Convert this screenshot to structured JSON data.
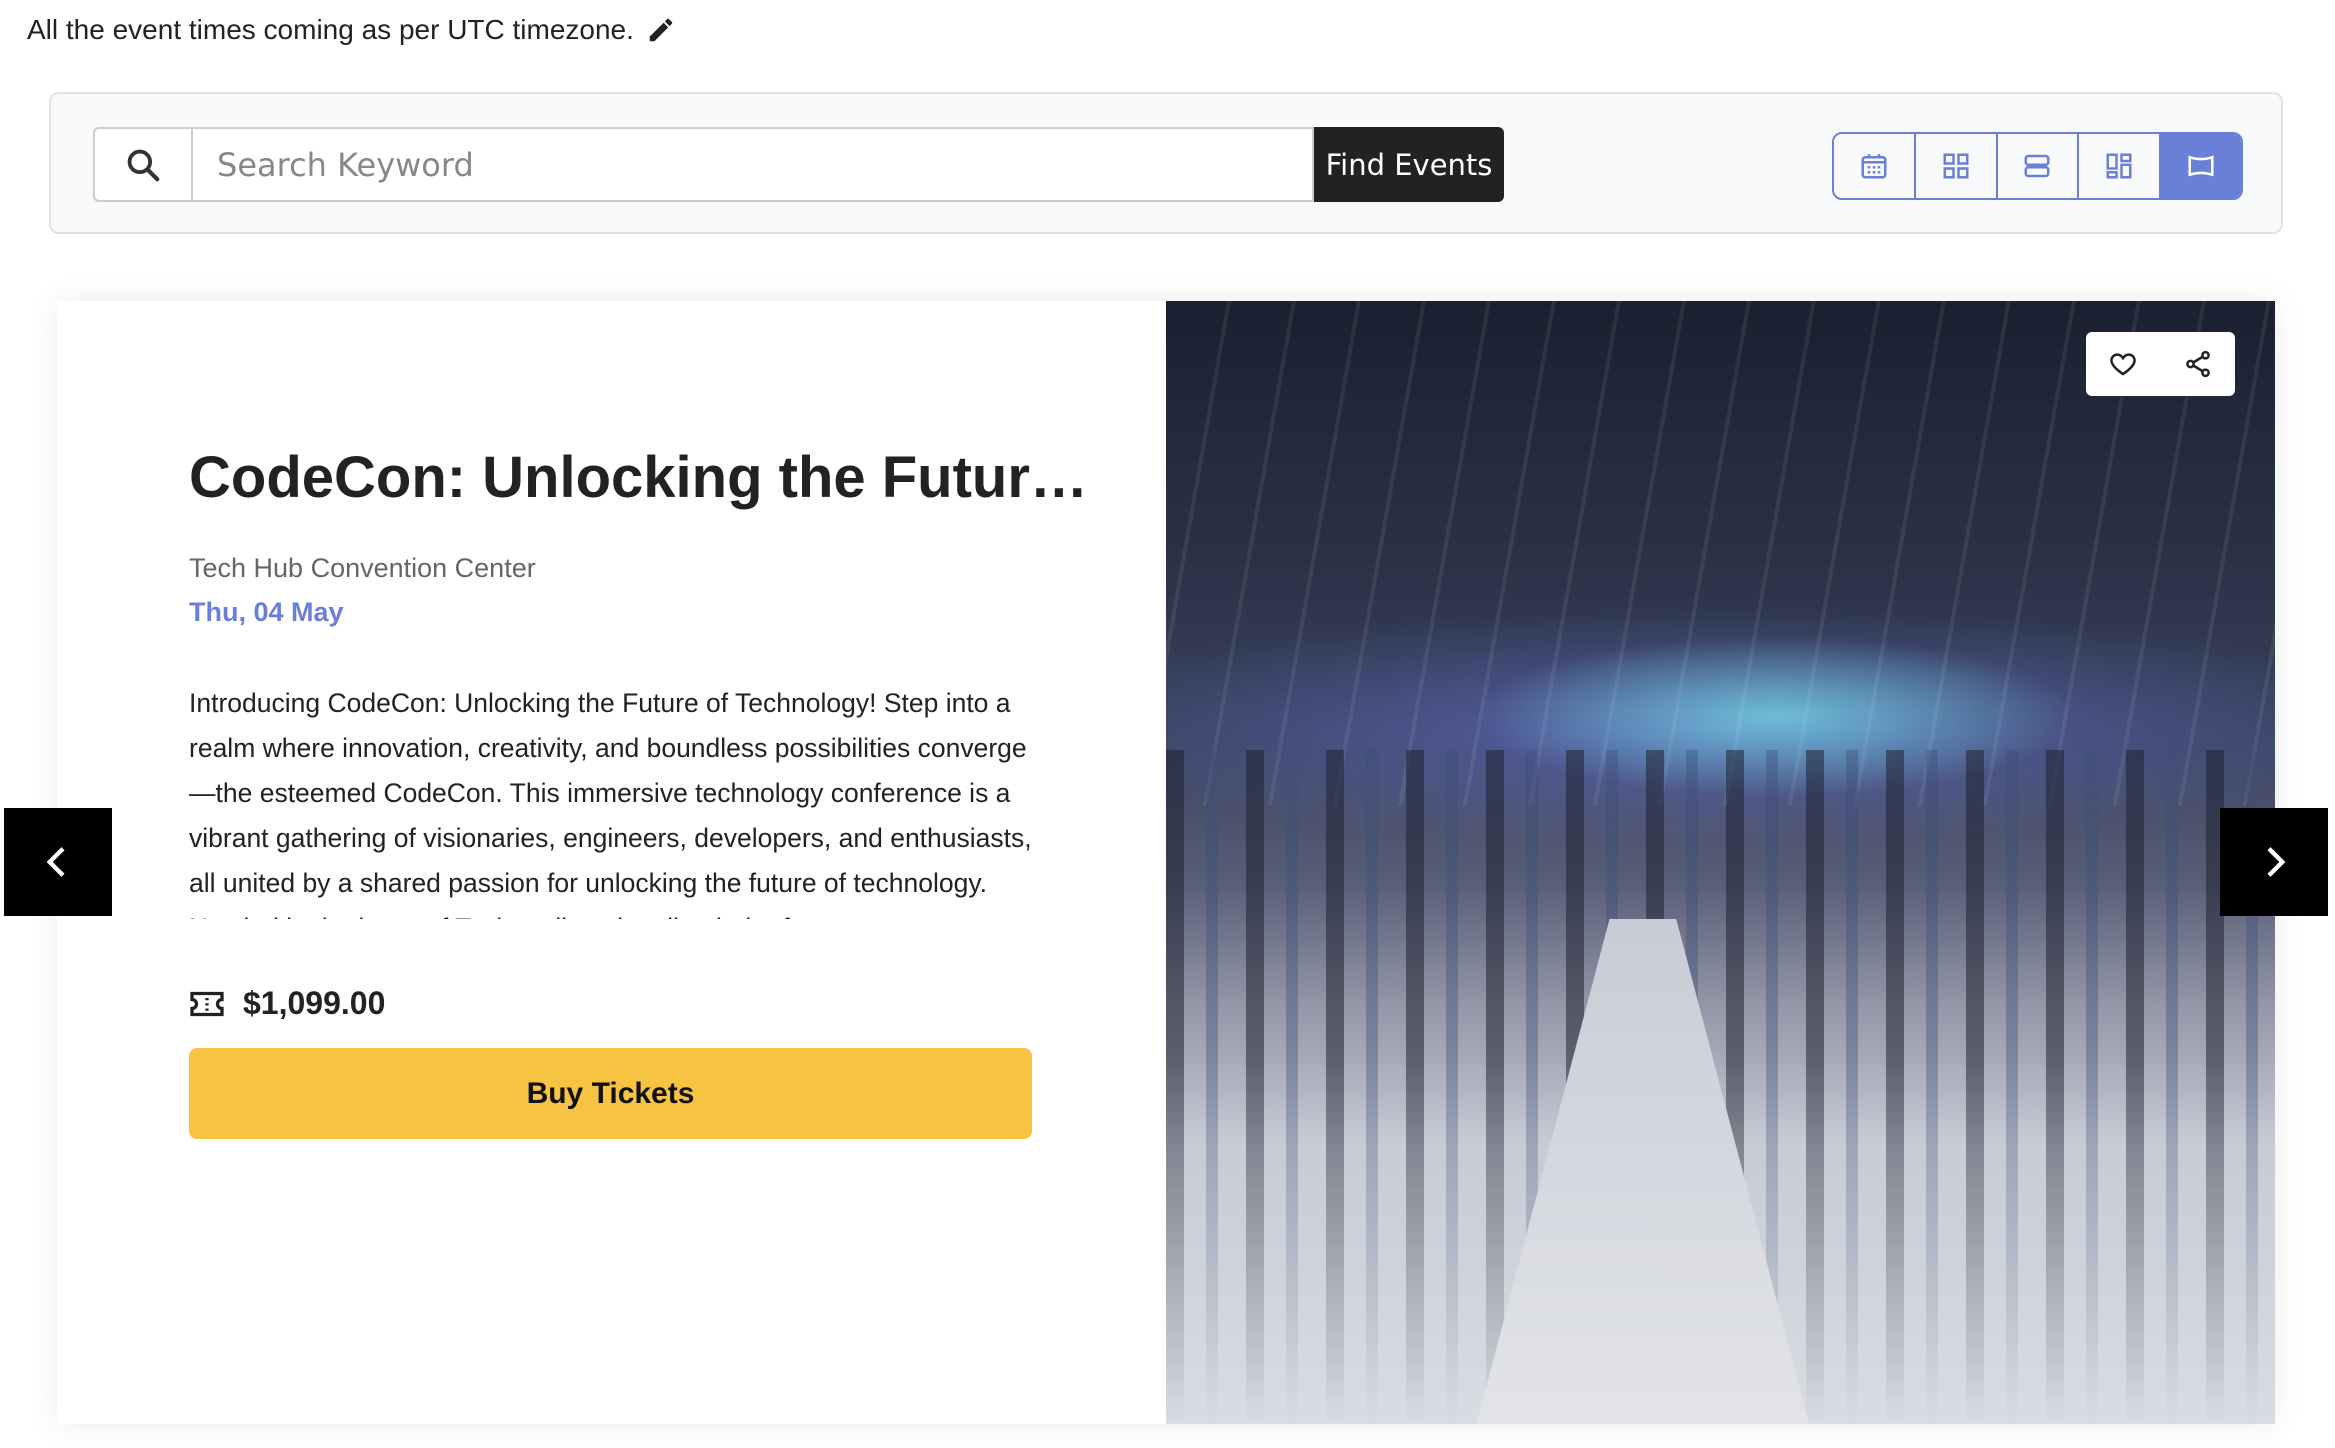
{
  "timezone_notice": {
    "text": "All the event times coming as per UTC timezone.",
    "icon": "pencil-icon"
  },
  "search": {
    "placeholder": "Search Keyword",
    "value": "",
    "button_label": "Find Events",
    "icon": "search-icon"
  },
  "view_toggles": [
    {
      "name": "calendar-view",
      "icon": "calendar-icon",
      "active": false
    },
    {
      "name": "grid-view",
      "icon": "grid-icon",
      "active": false
    },
    {
      "name": "list-view",
      "icon": "list-icon",
      "active": false
    },
    {
      "name": "masonry-view",
      "icon": "masonry-icon",
      "active": false
    },
    {
      "name": "slider-view",
      "icon": "slider-icon",
      "active": true
    }
  ],
  "event": {
    "title": "CodeCon: Unlocking the Future of Technology",
    "venue": "Tech Hub Convention Center",
    "date": "Thu, 04 May",
    "description": "Introducing CodeCon: Unlocking the Future of Technology! Step into a realm where innovation, creativity, and boundless possibilities converge—the esteemed CodeCon. This immersive technology conference is a vibrant gathering of visionaries, engineers, developers, and enthusiasts, all united by a shared passion for unlocking the future of technology. Nestled in the heart of Techopolis, a bustling hub of",
    "price": "$1,099.00",
    "buy_label": "Buy Tickets"
  },
  "colors": {
    "accent": "#6a80d6",
    "date": "#6a7fdb",
    "buy_button": "#f6c343",
    "find_button": "#222222"
  }
}
